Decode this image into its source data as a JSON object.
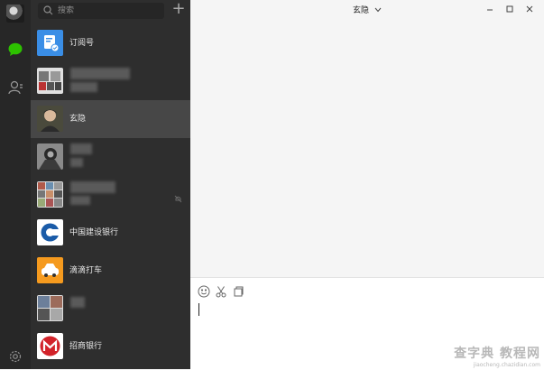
{
  "sidebar": {
    "nav": [
      {
        "name": "chat-icon",
        "active": true
      },
      {
        "name": "contacts-icon",
        "active": false
      },
      {
        "name": "settings-icon",
        "active": false
      }
    ],
    "accent_color": "#2dc100"
  },
  "search": {
    "placeholder": "搜索"
  },
  "conversations": [
    {
      "name": "订阅号",
      "selected": false
    },
    {
      "name": "",
      "selected": false
    },
    {
      "name": "玄隐",
      "selected": true
    },
    {
      "name": "",
      "selected": false
    },
    {
      "name": "",
      "selected": false,
      "muted": true
    },
    {
      "name": "中国建设银行",
      "selected": false
    },
    {
      "name": "滴滴打车",
      "selected": false
    },
    {
      "name": "",
      "selected": false
    },
    {
      "name": "招商银行",
      "selected": false
    }
  ],
  "chat": {
    "title": "玄隐",
    "toolbar": [
      "emoji-icon",
      "screenshot-scissors-icon",
      "file-icon"
    ]
  },
  "watermark": {
    "big": "查字典 教程网",
    "small": "jiaocheng.chazidian.com"
  }
}
